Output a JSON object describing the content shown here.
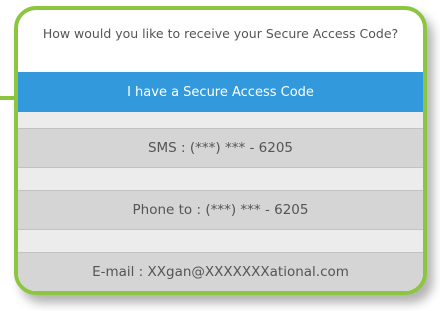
{
  "prompt": "How would you like to receive your Secure Access Code?",
  "options": [
    {
      "label": "I have a Secure Access Code"
    },
    {
      "label": "SMS : (***) *** - 6205"
    },
    {
      "label": "Phone to : (***) *** - 6205"
    },
    {
      "label": "E-mail : XXgan@XXXXXXXational.com"
    }
  ],
  "colors": {
    "accent_green": "#8cc63f",
    "primary_blue": "#3399dd",
    "option_gray": "#d5d5d5"
  }
}
